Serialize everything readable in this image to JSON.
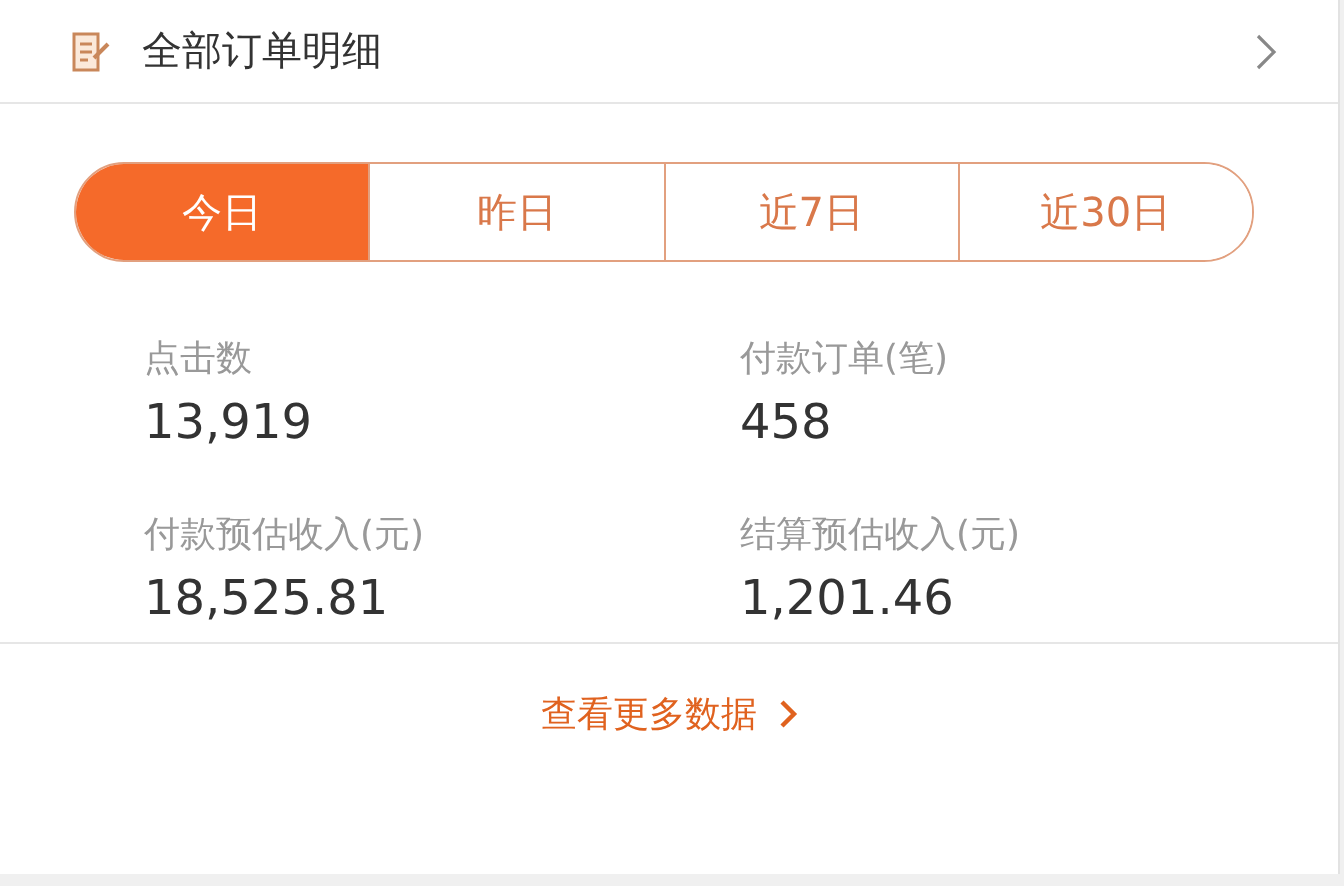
{
  "header": {
    "title": "全部订单明细"
  },
  "tabs": [
    {
      "label": "今日",
      "selected": true
    },
    {
      "label": "昨日",
      "selected": false
    },
    {
      "label": "近7日",
      "selected": false
    },
    {
      "label": "近30日",
      "selected": false
    }
  ],
  "stats": [
    {
      "label": "点击数",
      "value": "13,919"
    },
    {
      "label": "付款订单(笔)",
      "value": "458"
    },
    {
      "label": "付款预估收入(元)",
      "value": "18,525.81"
    },
    {
      "label": "结算预估收入(元)",
      "value": "1,201.46"
    }
  ],
  "footer": {
    "link": "查看更多数据"
  }
}
